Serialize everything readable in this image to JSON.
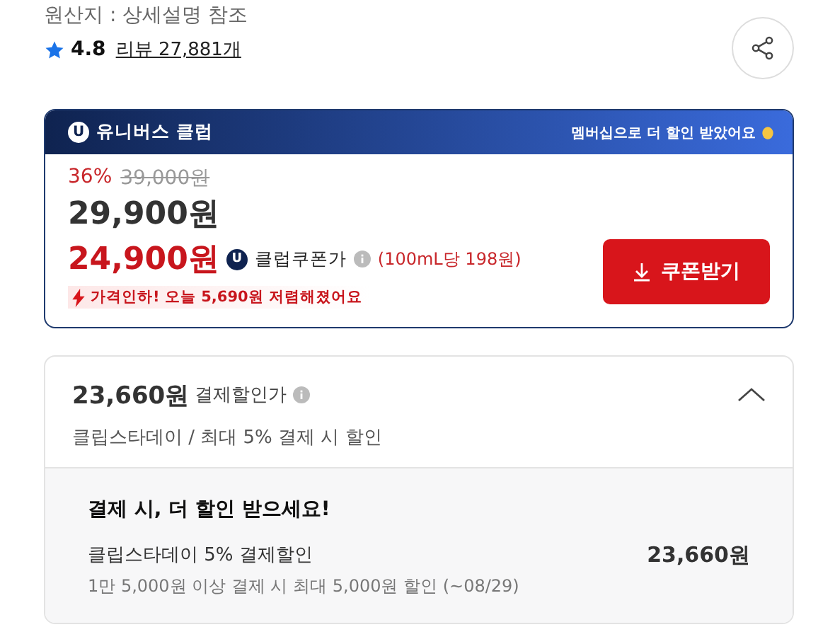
{
  "origin": "원산지 : 상세설명 참조",
  "rating": {
    "score": "4.8",
    "reviews": "리뷰 27,881개"
  },
  "club": {
    "logo": "U",
    "title": "유니버스 클럽",
    "promo": "멤버십으로 더 할인 받았어요",
    "discount": "36%",
    "original_price": "39,000원",
    "price": "29,900원",
    "coupon_price": "24,900원",
    "coupon_badge": "U",
    "coupon_label": "클럽쿠폰가",
    "unit_price": "(100mL당 198원)",
    "notice": "가격인하! 오늘 5,690원 저렴해졌어요",
    "button": "쿠폰받기"
  },
  "payment": {
    "price": "23,660원",
    "label": "결제할인가",
    "subtitle": "클립스타데이 / 최대 5% 결제 시 할인",
    "expanded": true,
    "heading": "결제 시, 더 할인 받으세요!",
    "offers": [
      {
        "name": "클립스타데이 5% 결제할인",
        "amount": "23,660원",
        "detail": "1만 5,000원 이상 결제 시 최대 5,000원 할인 (~08/29)"
      }
    ]
  }
}
